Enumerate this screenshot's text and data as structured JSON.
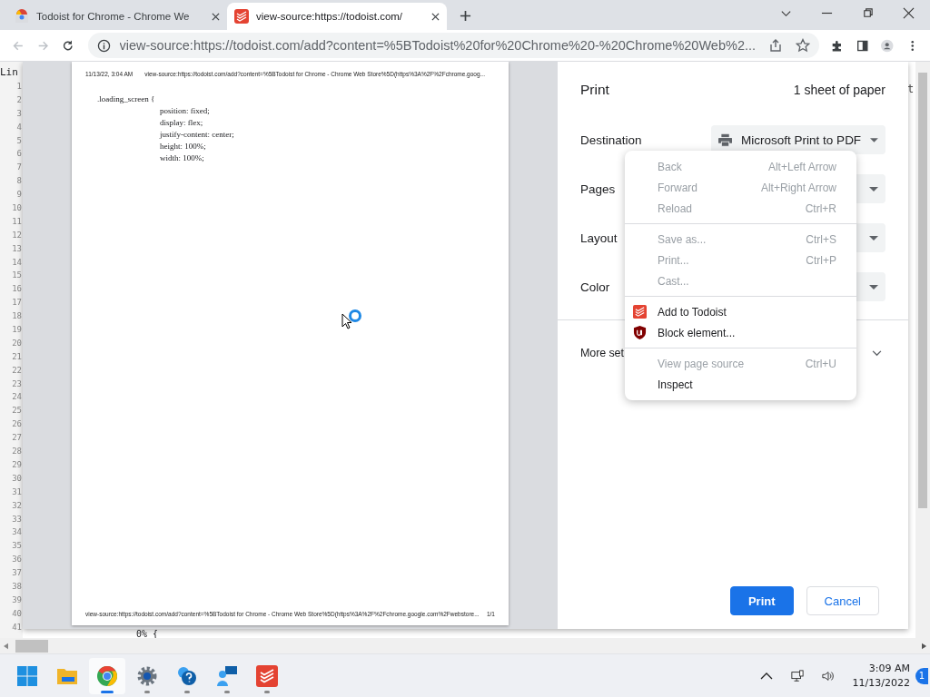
{
  "tabs": [
    {
      "title": "Todoist for Chrome - Chrome We",
      "selected": false
    },
    {
      "title": "view-source:https://todoist.com/",
      "selected": true
    }
  ],
  "toolbar": {
    "back_disabled": true,
    "forward_disabled": true,
    "url": "view-source:https://todoist.com/add?content=%5BTodoist%20for%20Chrome%20-%20Chrome%20Web%2..."
  },
  "view_source": {
    "header": "Lin",
    "line_numbers": [
      "1",
      "2",
      "3",
      "4",
      "5",
      "6",
      "7",
      "8",
      "9",
      "10",
      "11",
      "12",
      "13",
      "14",
      "15",
      "16",
      "17",
      "18",
      "19",
      "20",
      "21",
      "22",
      "23",
      "24",
      "25",
      "26",
      "27",
      "28",
      "29",
      "30",
      "31",
      "32",
      "33",
      "34",
      "35",
      "36",
      "37",
      "38",
      "39",
      "40",
      "41"
    ],
    "last_line": "0% {",
    "right_fragment": "t"
  },
  "preview": {
    "header_date": "11/13/22, 3:04 AM",
    "header_url": "view-source:https://todoist.com/add?content=%5BTodoist for Chrome - Chrome Web Store%5D(https%3A%2F%2Fchrome.goog...",
    "code": [
      {
        "text": ".loading_screen {",
        "indent": false
      },
      {
        "text": "position: fixed;",
        "indent": true
      },
      {
        "text": "display: flex;",
        "indent": true
      },
      {
        "text": "justify-content: center;",
        "indent": true
      },
      {
        "text": "height: 100%;",
        "indent": true
      },
      {
        "text": "width: 100%;",
        "indent": true
      }
    ],
    "footer_url": "view-source:https://todoist.com/add?content=%5BTodoist for Chrome - Chrome Web Store%5D(https%3A%2F%2Fchrome.google.com%2Fwebstore...",
    "page_count": "1/1"
  },
  "print_dialog": {
    "title": "Print",
    "sheets": "1 sheet of paper",
    "settings": [
      {
        "label": "Destination",
        "value": "Microsoft Print to PDF"
      },
      {
        "label": "Pages"
      },
      {
        "label": "Layout"
      },
      {
        "label": "Color"
      }
    ],
    "more_settings": "More set",
    "buttons": [
      {
        "label": "Print",
        "kind": "primary"
      },
      {
        "label": "Cancel",
        "kind": "secondary"
      }
    ]
  },
  "context_menu": [
    [
      {
        "label": "Back",
        "shortcut": "Alt+Left Arrow",
        "disabled": true
      },
      {
        "label": "Forward",
        "shortcut": "Alt+Right Arrow",
        "disabled": true
      },
      {
        "label": "Reload",
        "shortcut": "Ctrl+R",
        "disabled": true
      }
    ],
    [
      {
        "label": "Save as...",
        "shortcut": "Ctrl+S",
        "disabled": true
      },
      {
        "label": "Print...",
        "shortcut": "Ctrl+P",
        "disabled": true
      },
      {
        "label": "Cast...",
        "disabled": true
      }
    ],
    [
      {
        "label": "Add to Todoist",
        "disabled": false
      },
      {
        "label": "Block element...",
        "disabled": false
      }
    ],
    [
      {
        "label": "View page source",
        "shortcut": "Ctrl+U",
        "disabled": true
      },
      {
        "label": "Inspect",
        "disabled": false
      }
    ]
  ],
  "taskbar": {
    "apps": [
      {
        "running": false,
        "selected": false
      },
      {
        "running": false,
        "selected": false
      },
      {
        "running": true,
        "selected": true
      },
      {
        "running": true,
        "selected": false
      },
      {
        "running": true,
        "selected": false
      },
      {
        "running": true,
        "selected": false
      },
      {
        "running": true,
        "selected": false
      }
    ],
    "time": "3:09 AM",
    "date": "11/13/2022",
    "notifications": "1"
  }
}
